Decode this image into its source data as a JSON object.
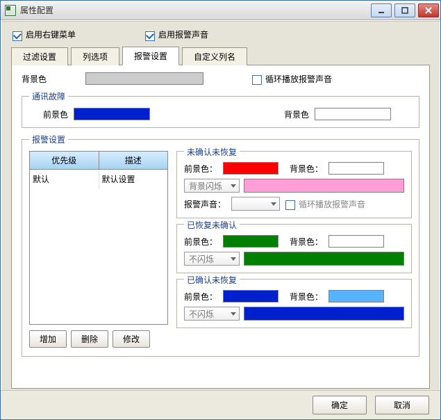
{
  "window": {
    "title": "属性配置"
  },
  "options": {
    "enable_context_menu_label": "启用右键菜单",
    "enable_context_menu_checked": true,
    "enable_alarm_sound_label": "启用报警声音",
    "enable_alarm_sound_checked": true
  },
  "tabs": {
    "filter": "过滤设置",
    "columns": "列选项",
    "alarm": "报警设置",
    "custom_col": "自定义列名",
    "active": "alarm"
  },
  "panel": {
    "bg_label": "背景色",
    "bg_color": "#cccccc",
    "loop_alarm_label": "循环播放报警声音",
    "loop_alarm_checked": false
  },
  "comm_fault": {
    "legend": "通讯故障",
    "fg_label": "前景色",
    "fg_color": "#0020d0",
    "bg_label": "背景色",
    "bg_color": "#ffffff"
  },
  "alarm_settings": {
    "legend": "报警设置"
  },
  "table": {
    "header_priority": "优先级",
    "header_desc": "描述",
    "rows": [
      {
        "priority": "默认",
        "desc": "默认设置"
      }
    ]
  },
  "buttons": {
    "add": "增加",
    "delete": "删除",
    "modify": "修改"
  },
  "group_unack_unrestored": {
    "legend": "未确认未恢复",
    "fg_label": "前景色：",
    "fg_color": "#ff0000",
    "bg_label": "背景色：",
    "bg_color": "#ffffff",
    "blink_select": "背景闪烁",
    "bar_color": "#ff9fd5",
    "sound_label": "报警声音：",
    "sound_select": "",
    "loop_label": "循环播放报警声音",
    "loop_checked": false
  },
  "group_restored_unack": {
    "legend": "已恢复未确认",
    "fg_label": "前景色：",
    "fg_color": "#008000",
    "bg_label": "背景色：",
    "bg_color": "#ffffff",
    "blink_select": "不闪烁",
    "bar_color": "#008000"
  },
  "group_ack_unrestored": {
    "legend": "已确认未恢复",
    "fg_label": "前景色：",
    "fg_color": "#0020d0",
    "bg_label": "背景色：",
    "bg_color": "#58b3ff",
    "blink_select": "不闪烁",
    "bar_color": "#0020d0"
  },
  "footer": {
    "ok": "确定",
    "cancel": "取消"
  }
}
